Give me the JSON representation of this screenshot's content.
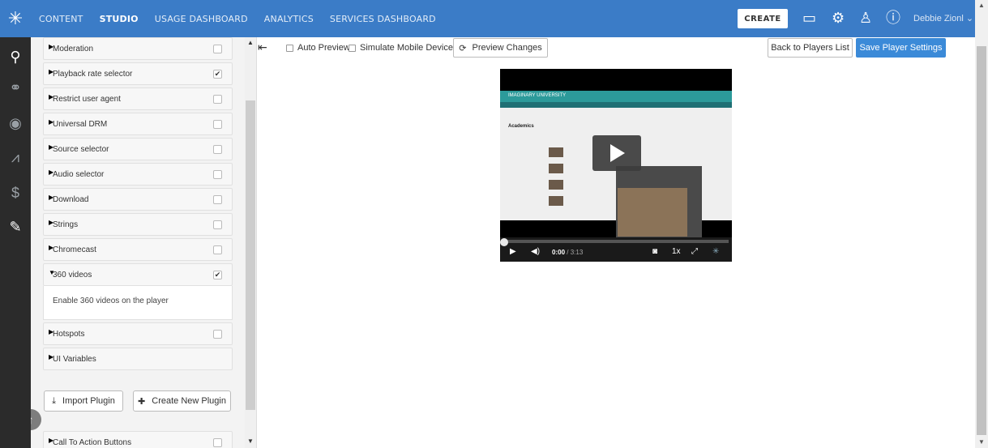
{
  "topbar": {
    "nav": [
      "CONTENT",
      "STUDIO",
      "USAGE DASHBOARD",
      "ANALYTICS",
      "SERVICES DASHBOARD"
    ],
    "active_nav": "STUDIO",
    "create_label": "CREATE",
    "user_name": "Debbie Zionl",
    "colors": {
      "bar": "#3b7cc7"
    }
  },
  "plugins": [
    {
      "label": "Moderation",
      "arrow": "▶",
      "checked": false
    },
    {
      "label": "Playback rate selector",
      "arrow": "▶",
      "checked": true
    },
    {
      "label": "Restrict user agent",
      "arrow": "▶",
      "checked": false
    },
    {
      "label": "Universal DRM",
      "arrow": "▶",
      "checked": false
    },
    {
      "label": "Source selector",
      "arrow": "▶",
      "checked": false
    },
    {
      "label": "Audio selector",
      "arrow": "▶",
      "checked": false
    },
    {
      "label": "Download",
      "arrow": "▶",
      "checked": false
    },
    {
      "label": "Strings",
      "arrow": "▶",
      "checked": false
    },
    {
      "label": "Chromecast",
      "arrow": "▶",
      "checked": false
    },
    {
      "label": "360 videos",
      "arrow": "▼",
      "checked": true
    },
    {
      "label": "Hotspots",
      "arrow": "▶",
      "checked": false
    },
    {
      "label": "UI Variables",
      "arrow": "▶",
      "checked": null
    },
    {
      "label": "Call To Action Buttons",
      "arrow": "▶",
      "checked": false
    }
  ],
  "expanded_desc": "Enable 360 videos on the player",
  "panel_buttons": {
    "import": "Import Plugin",
    "create": "Create New Plugin"
  },
  "preview": {
    "auto_preview": "Auto Preview",
    "simulate_mobile": "Simulate Mobile Device",
    "preview_changes": "Preview Changes",
    "back": "Back to Players List",
    "save": "Save Player Settings"
  },
  "player": {
    "time_current": "0:00",
    "time_total": "/ 3:13",
    "speed": "1x",
    "site_logo": "IMAGINARY UNIVERSITY",
    "site_title": "Academics"
  }
}
